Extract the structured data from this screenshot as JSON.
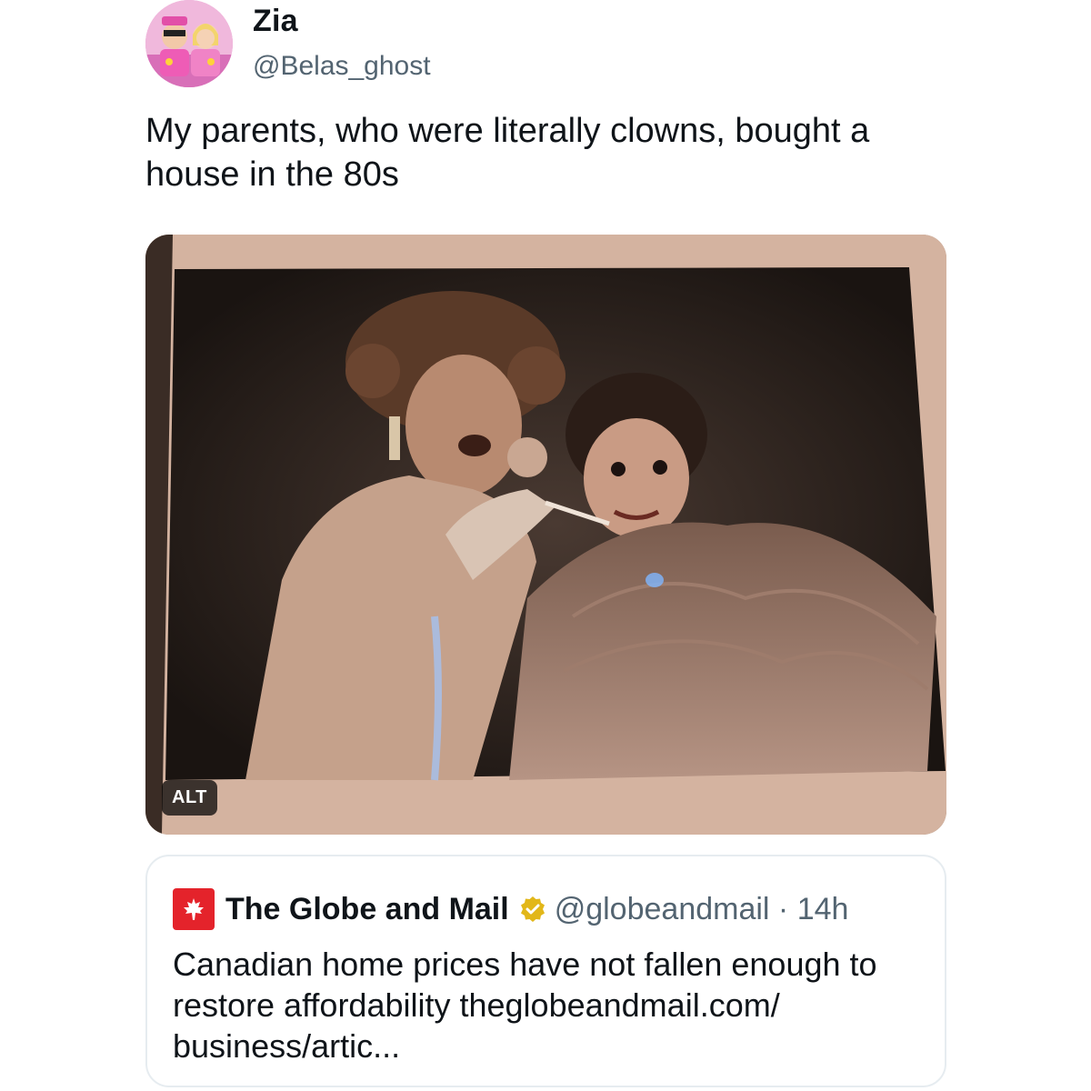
{
  "author": {
    "display_name": "Zia",
    "handle": "@Belas_ghost",
    "avatar_icon": "avatar-two-pink-figures"
  },
  "tweet": {
    "text": "My parents, who were literally clowns, bought a house in the 80s"
  },
  "media": {
    "alt_badge": "ALT",
    "description_icon": "photo-sepia-two-clowns"
  },
  "quoted_tweet": {
    "logo_icon": "maple-leaf-icon",
    "name": "The Globe and Mail",
    "verified_icon": "verified-badge-icon",
    "handle_time": "@globeandmail · 14h",
    "text": "Canadian home prices have not fallen enough to restore affordability theglobeandmail.com/ business/artic..."
  },
  "colors": {
    "secondary_text": "#536471",
    "brand_red": "#e4232b",
    "verified_gold": "#e2b719"
  }
}
